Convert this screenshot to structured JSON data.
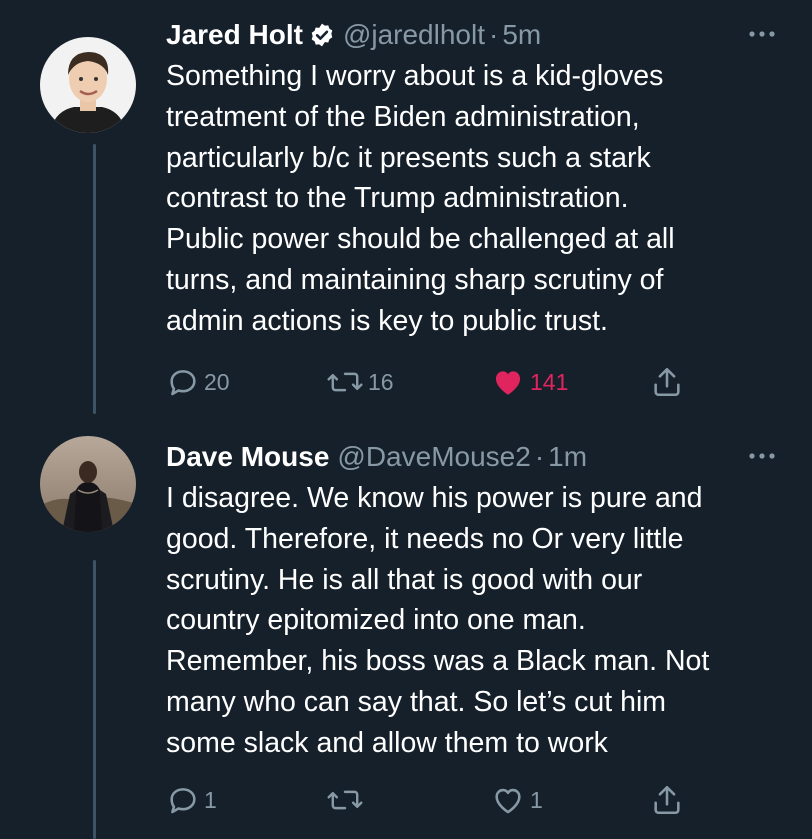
{
  "tweets": [
    {
      "name": "Jared Holt",
      "verified": true,
      "handle": "@jaredlholt",
      "separator": "·",
      "time": "5m",
      "text": "Something I worry about is a kid-gloves\ntreatment of the Biden administration,\nparticularly b/c it presents such a stark\ncontrast to the Trump administration.\nPublic power should be challenged at all\nturns, and maintaining sharp scrutiny of\nadmin actions is key to public trust.",
      "replies": "20",
      "retweets": "16",
      "likes": "141",
      "liked": true
    },
    {
      "name": "Dave Mouse",
      "verified": false,
      "handle": "@DaveMouse2",
      "separator": "·",
      "time": "1m",
      "text": "I disagree. We know his power is pure and\ngood. Therefore, it needs no Or very little\nscrutiny. He is all that is good with our\ncountry epitomized into one man.\nRemember, his boss was a Black man. Not\nmany who can say that. So let’s cut him\nsome slack and allow them to work",
      "replies": "1",
      "retweets": "",
      "likes": "1",
      "liked": false
    }
  ],
  "colors": {
    "background": "#15202b",
    "secondary_text": "#8899a6",
    "like_active": "#e0245e",
    "verified": "#ffffff",
    "thread_line": "#3d5466"
  },
  "icons": {
    "reply": "reply-icon",
    "retweet": "retweet-icon",
    "like": "heart-icon",
    "share": "share-icon",
    "more": "more-icon",
    "verified": "verified-badge-icon"
  }
}
